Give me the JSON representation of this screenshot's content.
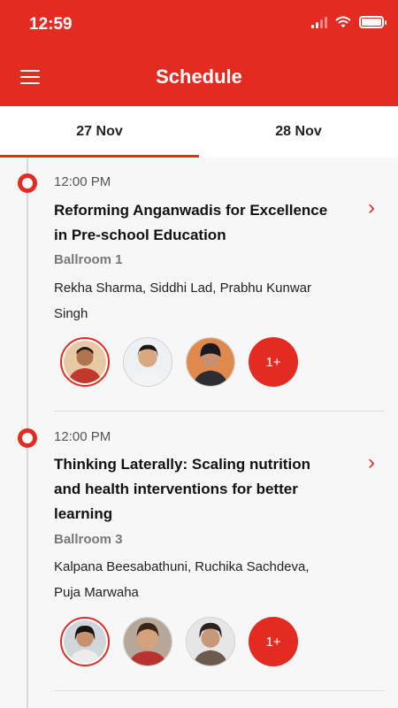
{
  "status": {
    "time": "12:59"
  },
  "header": {
    "title": "Schedule",
    "menu_icon": "hamburger-menu-icon"
  },
  "colors": {
    "accent": "#e32b22"
  },
  "tabs": [
    {
      "label": "27 Nov",
      "active": true
    },
    {
      "label": "28 Nov",
      "active": false
    }
  ],
  "sessions": [
    {
      "time": "12:00 PM",
      "title": "Reforming Anganwadis for Excellence in Pre-school Education",
      "room": "Ballroom 1",
      "speakers": "Rekha Sharma, Siddhi Lad, Prabhu Kunwar Singh",
      "more_label": "1+"
    },
    {
      "time": "12:00 PM",
      "title": "Thinking Laterally: Scaling nutrition and health interventions for better learning",
      "room": "Ballroom 3",
      "speakers": "Kalpana Beesabathuni, Ruchika Sachdeva, Puja Marwaha",
      "more_label": "1+"
    }
  ]
}
